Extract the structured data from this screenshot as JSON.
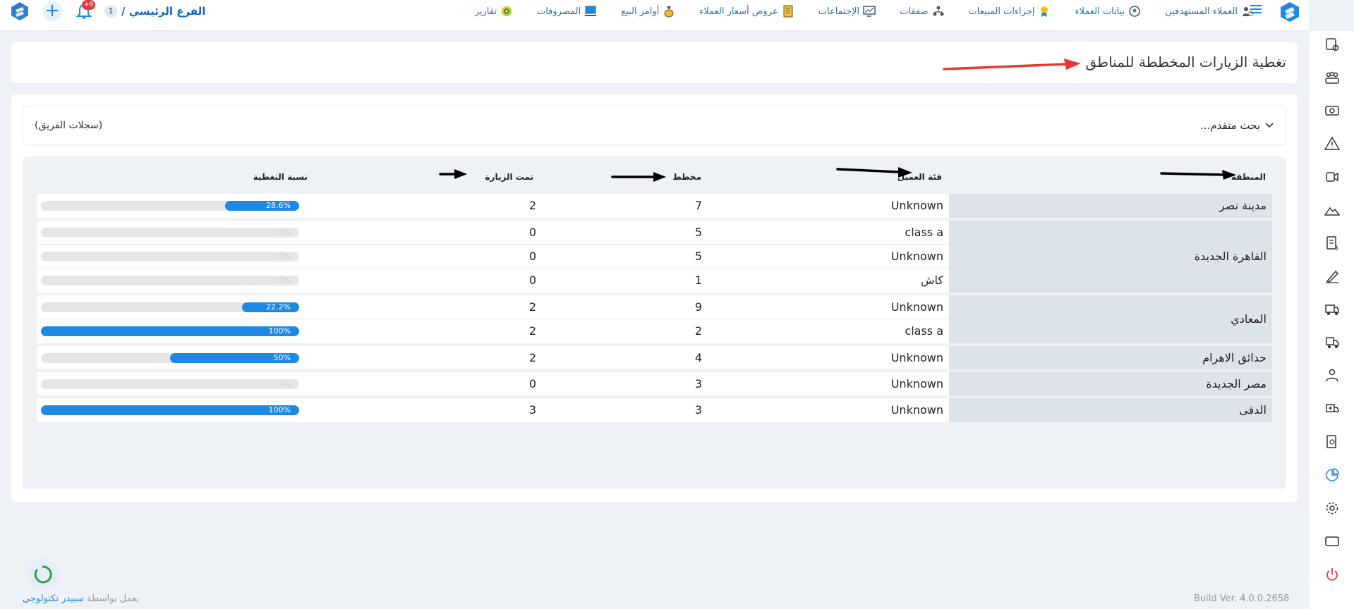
{
  "topbar": {
    "branch_num": "1",
    "branch_label": "الفرع الرئيسي /",
    "notification_count": "+9",
    "nav": [
      {
        "label": "العملاء المستهدفين",
        "icon": "target-customers-icon"
      },
      {
        "label": "بيانات العملاء",
        "icon": "customer-data-icon"
      },
      {
        "label": "إجراءات المبيعات",
        "icon": "sales-actions-icon"
      },
      {
        "label": "صفقات",
        "icon": "deals-icon"
      },
      {
        "label": "الإجتماعات",
        "icon": "meetings-icon"
      },
      {
        "label": "عروض أسعار العملاء",
        "icon": "quotes-icon"
      },
      {
        "label": "أوامر البيع",
        "icon": "sales-orders-icon"
      },
      {
        "label": "المصروفات",
        "icon": "expenses-icon"
      },
      {
        "label": "تقارير",
        "icon": "reports-icon"
      }
    ]
  },
  "page": {
    "title": "تغطية الزيارات المخططة للمناطق"
  },
  "search": {
    "toggle_label": "بحث متقدم...",
    "team_label": "(سجلات الفريق)"
  },
  "table": {
    "headers": {
      "region": "المنطقة",
      "customer_class": "فئة العميل",
      "planned": "مخطط",
      "visited": "تمت الزيارة",
      "coverage": "نسبة التغطية"
    },
    "rows": [
      {
        "region": "مدينة نصر",
        "class": "Unknown",
        "planned": "7",
        "visited": "2",
        "coverage": "28.6%",
        "pct": 28.6
      },
      {
        "region": "القاهرة الجديدة",
        "class": "class a",
        "planned": "5",
        "visited": "0",
        "coverage": "0%",
        "pct": 0
      },
      {
        "region": "",
        "class": "Unknown",
        "planned": "5",
        "visited": "0",
        "coverage": "0%",
        "pct": 0
      },
      {
        "region": "",
        "class": "كاش",
        "planned": "1",
        "visited": "0",
        "coverage": "0%",
        "pct": 0
      },
      {
        "region": "المعادي",
        "class": "Unknown",
        "planned": "9",
        "visited": "2",
        "coverage": "22.2%",
        "pct": 22.2
      },
      {
        "region": "",
        "class": "class a",
        "planned": "2",
        "visited": "2",
        "coverage": "100%",
        "pct": 100
      },
      {
        "region": "حدائق الاهرام",
        "class": "Unknown",
        "planned": "4",
        "visited": "2",
        "coverage": "50%",
        "pct": 50
      },
      {
        "region": "مصر الجديدة",
        "class": "Unknown",
        "planned": "3",
        "visited": "0",
        "coverage": "0%",
        "pct": 0
      },
      {
        "region": "الدقى",
        "class": "Unknown",
        "planned": "3",
        "visited": "3",
        "coverage": "100%",
        "pct": 100
      }
    ]
  },
  "footer": {
    "powered_prefix": "يعمل بواسطة",
    "powered_brand": "سبيدر تكنولوجي",
    "build": "Build Ver. 4.0.0.2658"
  },
  "colors": {
    "accent": "#1e88e5",
    "annotation_red": "#e53935",
    "region_bg": "#dde3ea"
  }
}
